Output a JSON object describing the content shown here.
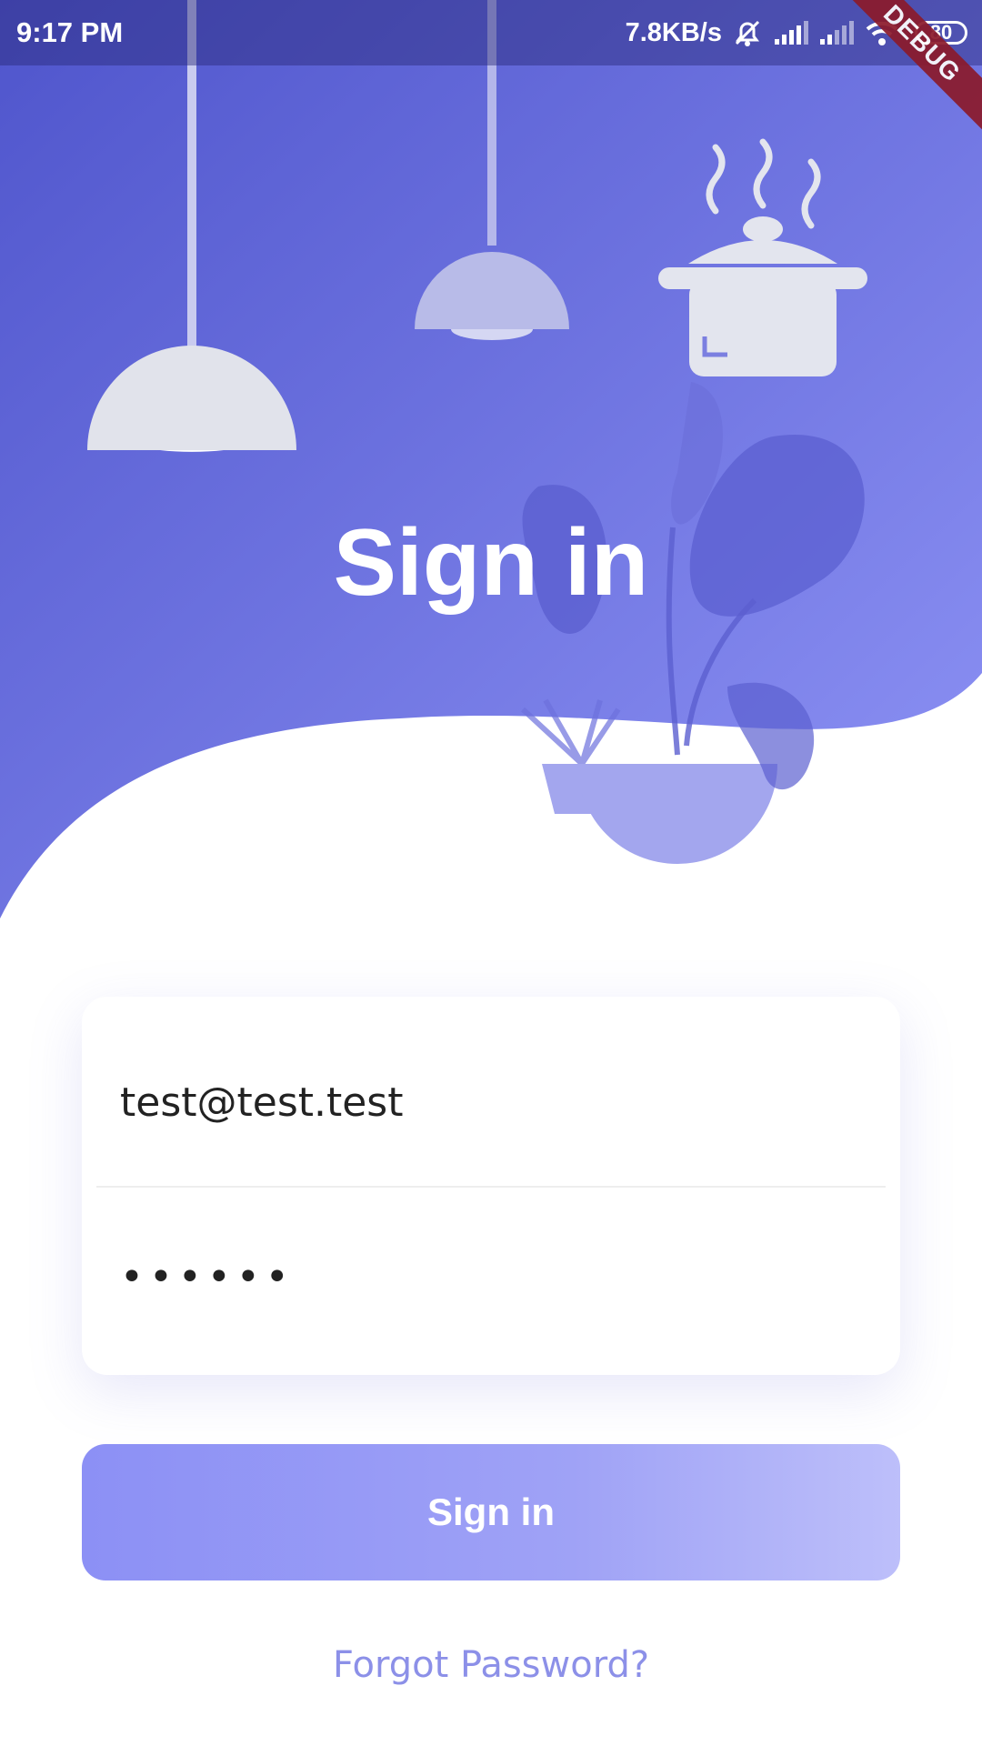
{
  "status_bar": {
    "time": "9:17 PM",
    "network_speed": "7.8KB/s",
    "battery": "80",
    "icons": [
      "mute-bell-icon",
      "signal-icon",
      "signal-icon",
      "wifi-icon",
      "battery-icon"
    ]
  },
  "debug_banner": "DEBUG",
  "hero": {
    "title": "Sign in",
    "illustrations": [
      "pendant-lamp-icon",
      "pendant-lamp-icon",
      "cooking-pot-icon",
      "potted-plant-icon"
    ]
  },
  "form": {
    "email_value": "test@test.test",
    "password_value": "••••••"
  },
  "submit_label": "Sign in",
  "forgot_password_label": "Forgot Password?",
  "colors": {
    "gradient_start": "#4f55cc",
    "gradient_end": "#8e93f5",
    "button_start": "#8c90f5",
    "button_end": "#bdbffa",
    "link": "#8c90e8"
  }
}
